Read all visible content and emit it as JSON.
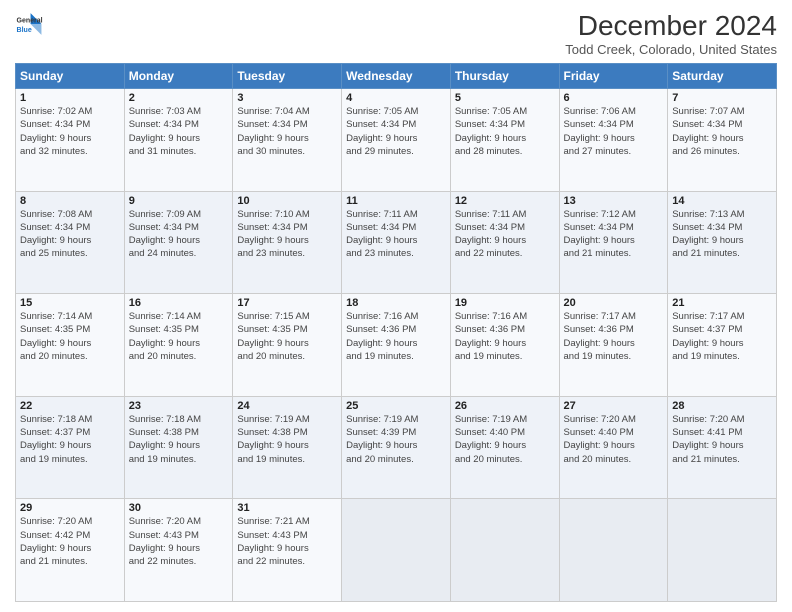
{
  "header": {
    "logo_line1": "General",
    "logo_line2": "Blue",
    "title": "December 2024",
    "subtitle": "Todd Creek, Colorado, United States"
  },
  "days_of_week": [
    "Sunday",
    "Monday",
    "Tuesday",
    "Wednesday",
    "Thursday",
    "Friday",
    "Saturday"
  ],
  "weeks": [
    [
      {
        "day": 1,
        "sunrise": "7:02 AM",
        "sunset": "4:34 PM",
        "daylight": "9 hours and 32 minutes."
      },
      {
        "day": 2,
        "sunrise": "7:03 AM",
        "sunset": "4:34 PM",
        "daylight": "9 hours and 31 minutes."
      },
      {
        "day": 3,
        "sunrise": "7:04 AM",
        "sunset": "4:34 PM",
        "daylight": "9 hours and 30 minutes."
      },
      {
        "day": 4,
        "sunrise": "7:05 AM",
        "sunset": "4:34 PM",
        "daylight": "9 hours and 29 minutes."
      },
      {
        "day": 5,
        "sunrise": "7:05 AM",
        "sunset": "4:34 PM",
        "daylight": "9 hours and 28 minutes."
      },
      {
        "day": 6,
        "sunrise": "7:06 AM",
        "sunset": "4:34 PM",
        "daylight": "9 hours and 27 minutes."
      },
      {
        "day": 7,
        "sunrise": "7:07 AM",
        "sunset": "4:34 PM",
        "daylight": "9 hours and 26 minutes."
      }
    ],
    [
      {
        "day": 8,
        "sunrise": "7:08 AM",
        "sunset": "4:34 PM",
        "daylight": "9 hours and 25 minutes."
      },
      {
        "day": 9,
        "sunrise": "7:09 AM",
        "sunset": "4:34 PM",
        "daylight": "9 hours and 24 minutes."
      },
      {
        "day": 10,
        "sunrise": "7:10 AM",
        "sunset": "4:34 PM",
        "daylight": "9 hours and 23 minutes."
      },
      {
        "day": 11,
        "sunrise": "7:11 AM",
        "sunset": "4:34 PM",
        "daylight": "9 hours and 23 minutes."
      },
      {
        "day": 12,
        "sunrise": "7:11 AM",
        "sunset": "4:34 PM",
        "daylight": "9 hours and 22 minutes."
      },
      {
        "day": 13,
        "sunrise": "7:12 AM",
        "sunset": "4:34 PM",
        "daylight": "9 hours and 21 minutes."
      },
      {
        "day": 14,
        "sunrise": "7:13 AM",
        "sunset": "4:34 PM",
        "daylight": "9 hours and 21 minutes."
      }
    ],
    [
      {
        "day": 15,
        "sunrise": "7:14 AM",
        "sunset": "4:35 PM",
        "daylight": "9 hours and 20 minutes."
      },
      {
        "day": 16,
        "sunrise": "7:14 AM",
        "sunset": "4:35 PM",
        "daylight": "9 hours and 20 minutes."
      },
      {
        "day": 17,
        "sunrise": "7:15 AM",
        "sunset": "4:35 PM",
        "daylight": "9 hours and 20 minutes."
      },
      {
        "day": 18,
        "sunrise": "7:16 AM",
        "sunset": "4:36 PM",
        "daylight": "9 hours and 19 minutes."
      },
      {
        "day": 19,
        "sunrise": "7:16 AM",
        "sunset": "4:36 PM",
        "daylight": "9 hours and 19 minutes."
      },
      {
        "day": 20,
        "sunrise": "7:17 AM",
        "sunset": "4:36 PM",
        "daylight": "9 hours and 19 minutes."
      },
      {
        "day": 21,
        "sunrise": "7:17 AM",
        "sunset": "4:37 PM",
        "daylight": "9 hours and 19 minutes."
      }
    ],
    [
      {
        "day": 22,
        "sunrise": "7:18 AM",
        "sunset": "4:37 PM",
        "daylight": "9 hours and 19 minutes."
      },
      {
        "day": 23,
        "sunrise": "7:18 AM",
        "sunset": "4:38 PM",
        "daylight": "9 hours and 19 minutes."
      },
      {
        "day": 24,
        "sunrise": "7:19 AM",
        "sunset": "4:38 PM",
        "daylight": "9 hours and 19 minutes."
      },
      {
        "day": 25,
        "sunrise": "7:19 AM",
        "sunset": "4:39 PM",
        "daylight": "9 hours and 20 minutes."
      },
      {
        "day": 26,
        "sunrise": "7:19 AM",
        "sunset": "4:40 PM",
        "daylight": "9 hours and 20 minutes."
      },
      {
        "day": 27,
        "sunrise": "7:20 AM",
        "sunset": "4:40 PM",
        "daylight": "9 hours and 20 minutes."
      },
      {
        "day": 28,
        "sunrise": "7:20 AM",
        "sunset": "4:41 PM",
        "daylight": "9 hours and 21 minutes."
      }
    ],
    [
      {
        "day": 29,
        "sunrise": "7:20 AM",
        "sunset": "4:42 PM",
        "daylight": "9 hours and 21 minutes."
      },
      {
        "day": 30,
        "sunrise": "7:20 AM",
        "sunset": "4:43 PM",
        "daylight": "9 hours and 22 minutes."
      },
      {
        "day": 31,
        "sunrise": "7:21 AM",
        "sunset": "4:43 PM",
        "daylight": "9 hours and 22 minutes."
      },
      null,
      null,
      null,
      null
    ]
  ],
  "labels": {
    "sunrise": "Sunrise:",
    "sunset": "Sunset:",
    "daylight": "Daylight:"
  }
}
